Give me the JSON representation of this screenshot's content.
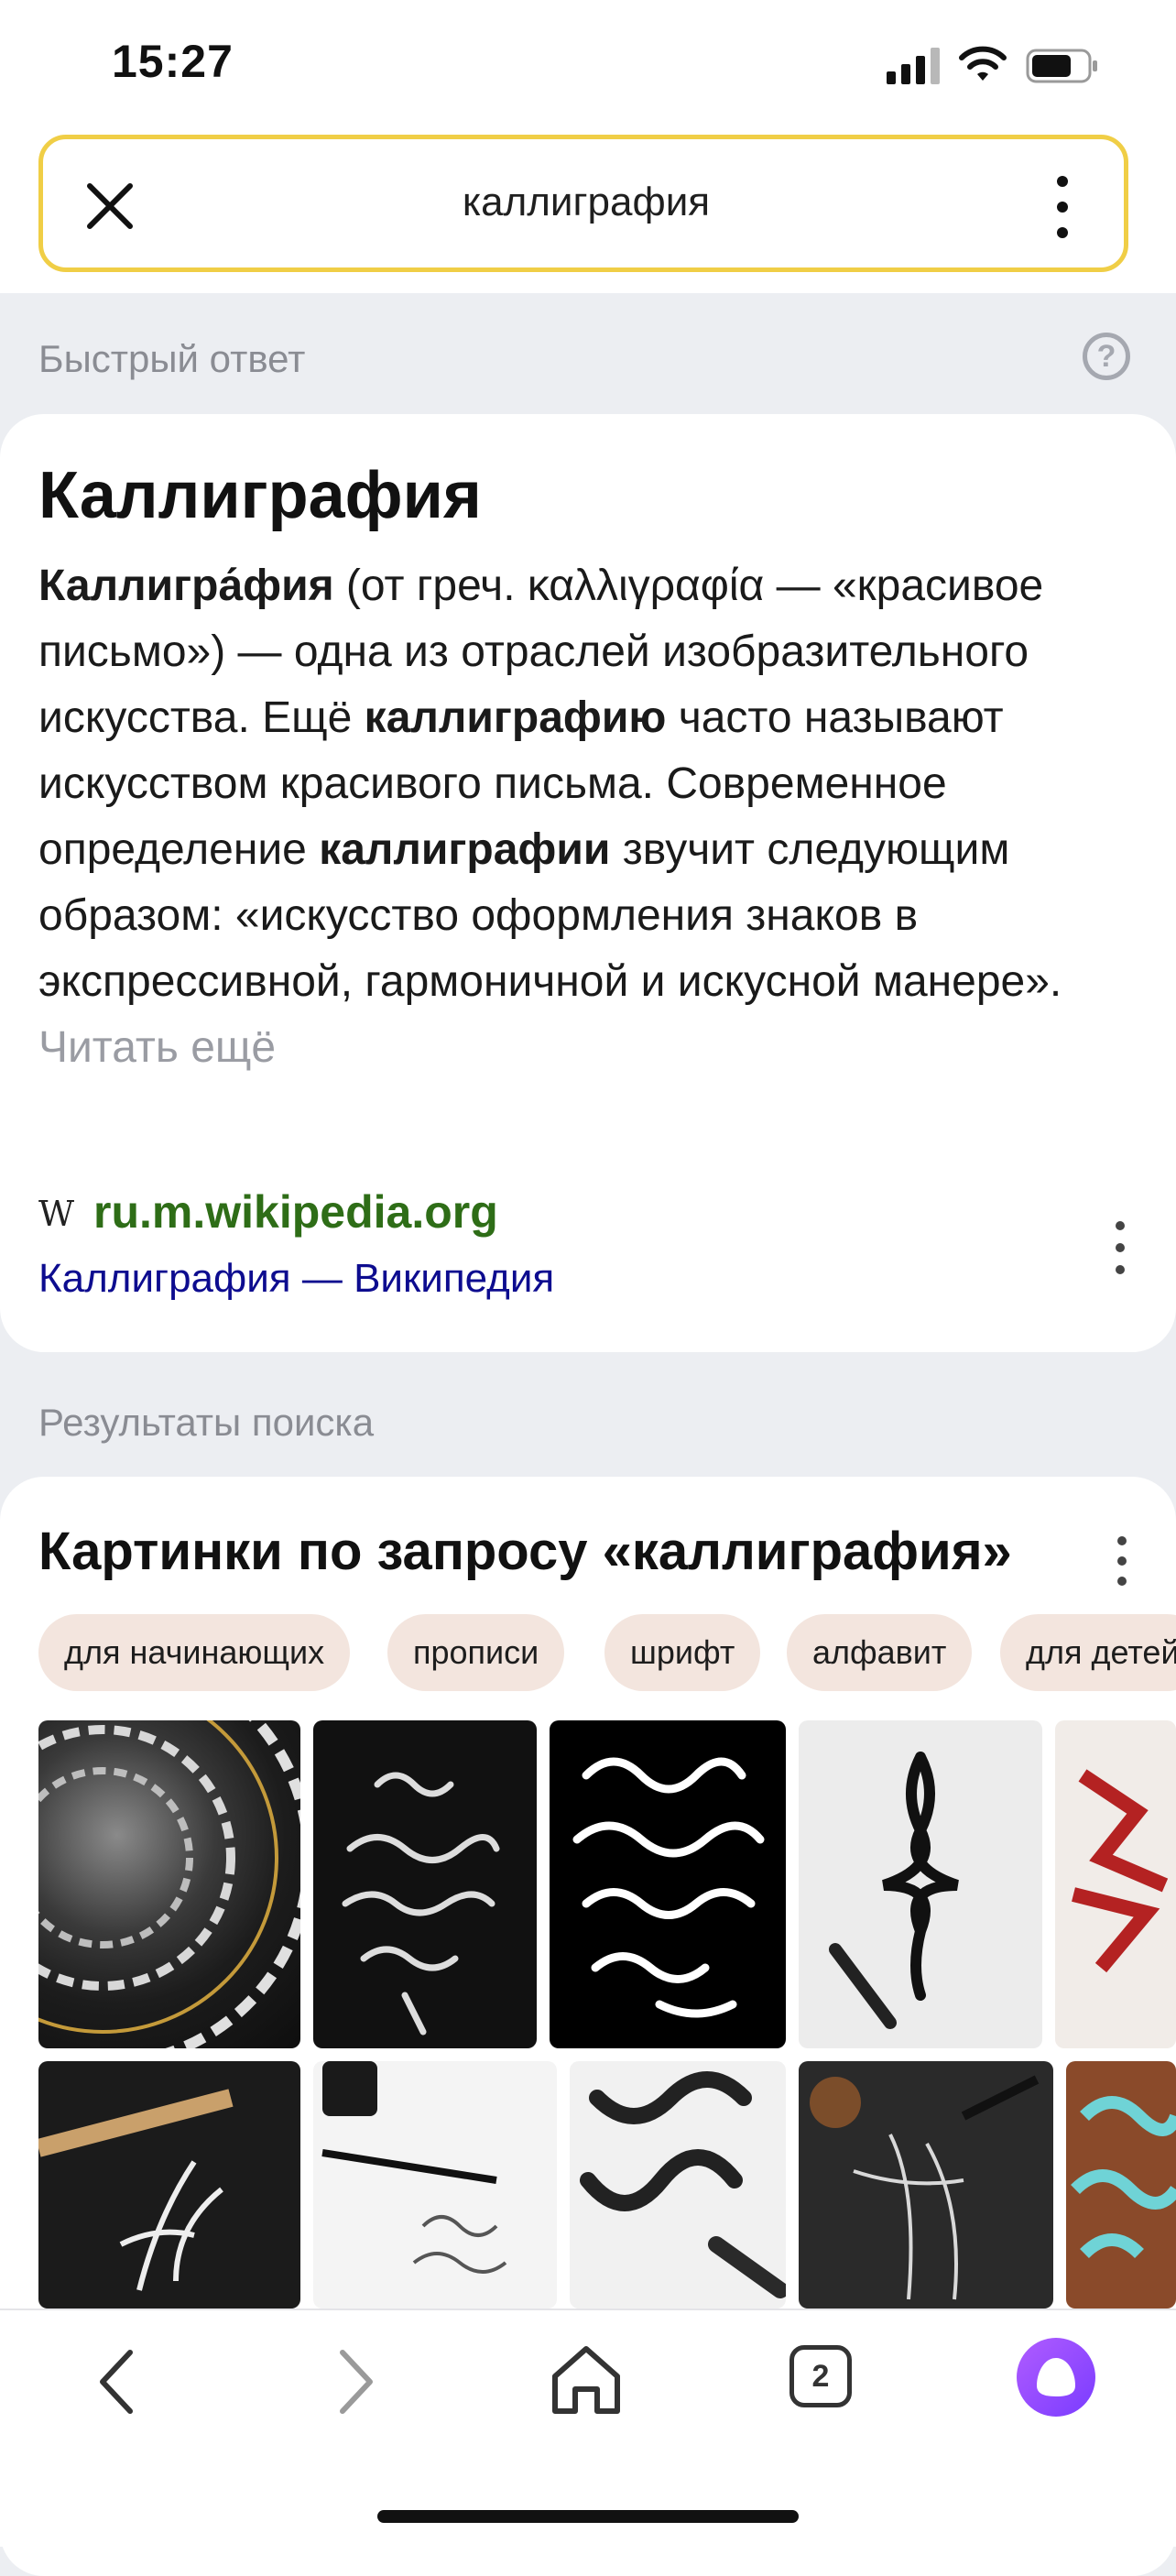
{
  "status_bar": {
    "time": "15:27"
  },
  "search": {
    "query": "каллиграфия"
  },
  "quick_answer": {
    "section_label": "Быстрый ответ",
    "help": "?",
    "title": "Каллиграфия",
    "paragraph": {
      "term1": "Каллигра́фия",
      "part1": " (от греч. καλλιγραφία — «красивое письмо») — одна из отраслей изобразительного искусства. Ещё ",
      "term2": "каллиграфию",
      "part2": " часто называют искусством красивого письма. Современное определение ",
      "term3": "каллиграфии",
      "part3": " звучит следующим образом: «искусство оформления знаков в экспрессивной, гармоничной и искусной манере». ",
      "read_more": "Читать ещё"
    },
    "source": {
      "icon_letter": "W",
      "domain": "ru.m.wikipedia.org",
      "link": "Каллиграфия — Википедия"
    }
  },
  "results": {
    "section_label": "Результаты поиска",
    "images_title": "Картинки по запросу «каллиграфия»",
    "chips": [
      "для начинающих",
      "прописи",
      "шрифт",
      "алфавит",
      "для детей"
    ]
  },
  "bottom_nav": {
    "tabs_count": "2"
  },
  "colors": {
    "search_border": "#f0ce46",
    "wiki_domain": "#2e6d17",
    "wiki_link": "#0d0c8f",
    "chip_bg": "#f3e5de",
    "alice_purple": "#8b4dff"
  }
}
